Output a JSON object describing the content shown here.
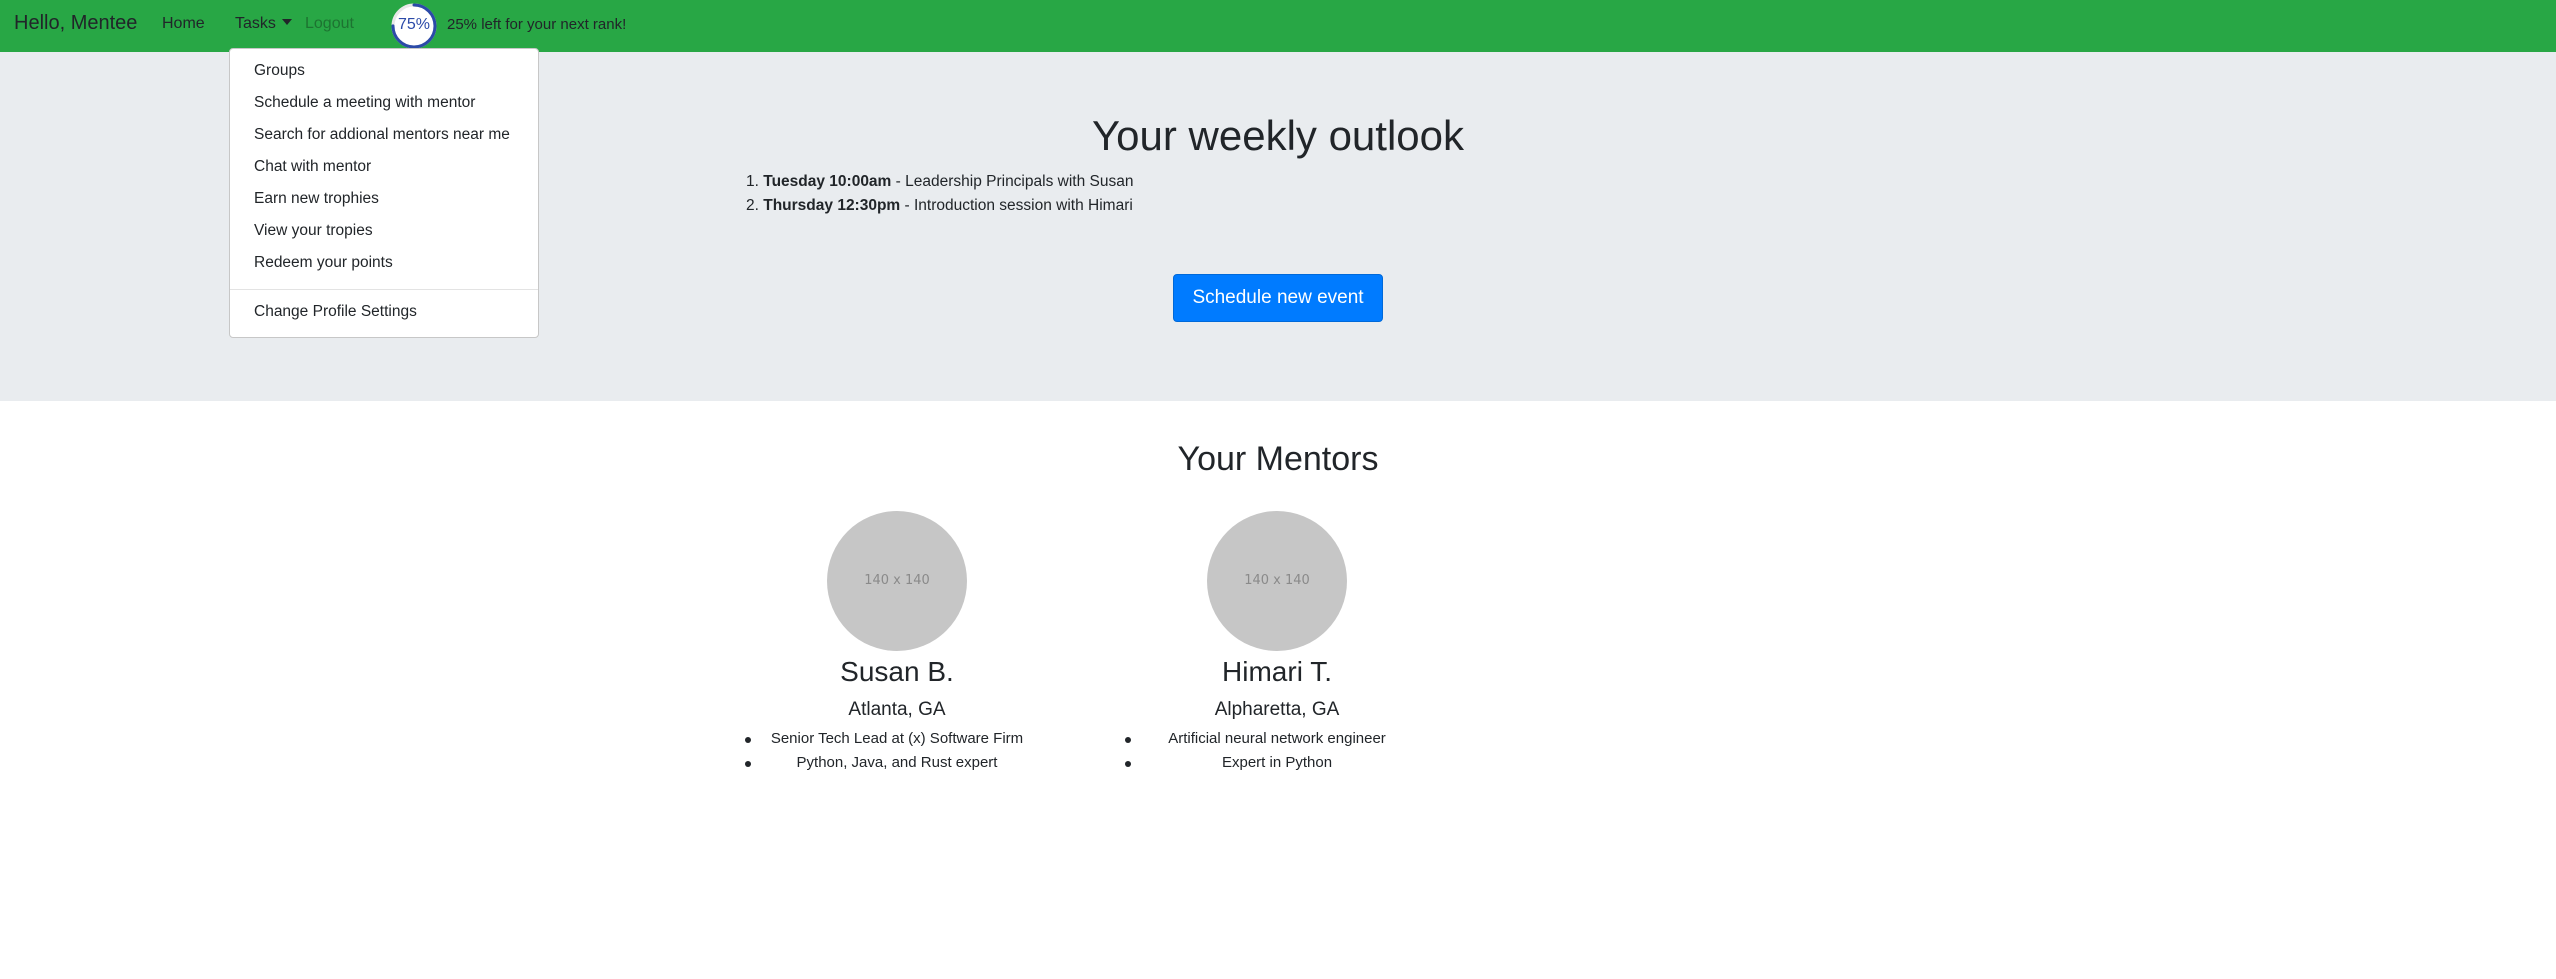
{
  "navbar": {
    "brand": "Hello, Mentee",
    "home": "Home",
    "tasks": "Tasks",
    "logout": "Logout",
    "progress_percent": "75%",
    "progress_value": 0.75,
    "rank_text": "25% left for your next rank!",
    "colors": {
      "bar": "#28a745",
      "ring": "#2b4aa8"
    }
  },
  "dropdown": {
    "items": [
      "Groups",
      "Schedule a meeting with mentor",
      "Search for addional mentors near me",
      "Chat with mentor",
      "Earn new trophies",
      "View your tropies",
      "Redeem your points"
    ],
    "settings": "Change Profile Settings"
  },
  "outlook": {
    "title": "Your weekly outlook",
    "events": [
      {
        "num": "1.",
        "time": "Tuesday 10:00am",
        "desc": " - Leadership Principals with Susan"
      },
      {
        "num": "2.",
        "time": "Thursday 12:30pm",
        "desc": " - Introduction session with Himari"
      }
    ],
    "button": "Schedule new event"
  },
  "mentors": {
    "title": "Your Mentors",
    "list": [
      {
        "avatar": "140 x 140",
        "name": "Susan B.",
        "location": "Atlanta, GA",
        "details": [
          "Senior Tech Lead at (x) Software Firm",
          "Python, Java, and Rust expert"
        ]
      },
      {
        "avatar": "140 x 140",
        "name": "Himari T.",
        "location": "Alpharetta, GA",
        "details": [
          "Artificial neural network engineer",
          "Expert in Python"
        ]
      }
    ]
  }
}
